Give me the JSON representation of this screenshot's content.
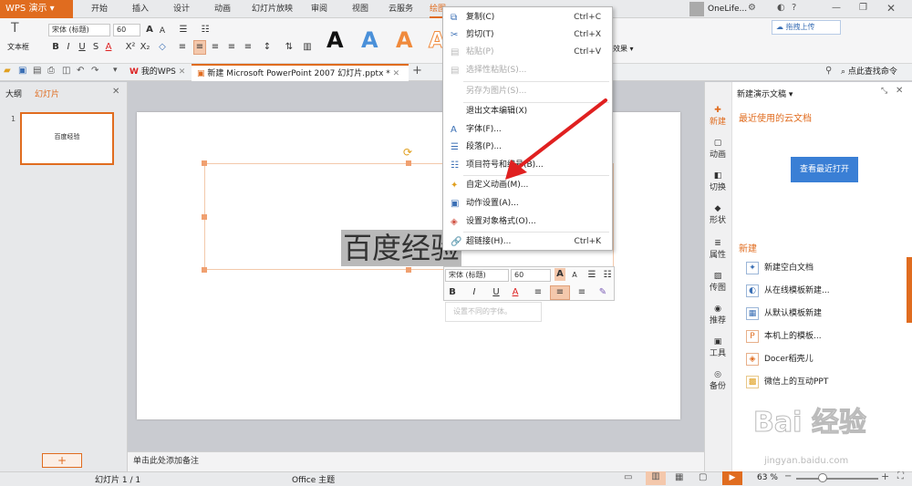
{
  "app": {
    "name": "WPS 演示"
  },
  "menu_tabs": [
    "开始",
    "插入",
    "设计",
    "动画",
    "幻灯片放映",
    "审阅",
    "视图",
    "云服务",
    "绘图"
  ],
  "user": {
    "name": "OneLife..."
  },
  "cloud_upload": "拖拽上传",
  "ribbon": {
    "textbox_label": "文本框",
    "font_name": "宋体 (标题)",
    "font_size": "60",
    "effects_label": "效果"
  },
  "doc_tabs": [
    {
      "label": "我的WPS"
    },
    {
      "label": "新建 Microsoft PowerPoint 2007 幻灯片.pptx *"
    }
  ],
  "search_command": "点此查找命令",
  "left_panel": {
    "tab_outline": "大纲",
    "tab_slides": "幻灯片",
    "slide_number": "1",
    "thumb_text": "百度经验"
  },
  "slide": {
    "text": "百度经验"
  },
  "notes_placeholder": "单击此处添加备注",
  "context_menu": [
    {
      "label": "复制(C)",
      "shortcut": "Ctrl+C",
      "icon": "copy-icon",
      "disabled": false
    },
    {
      "label": "剪切(T)",
      "shortcut": "Ctrl+X",
      "icon": "cut-icon",
      "disabled": false
    },
    {
      "label": "粘贴(P)",
      "shortcut": "Ctrl+V",
      "icon": "paste-icon",
      "disabled": true
    },
    {
      "label": "选择性粘贴(S)...",
      "shortcut": "",
      "icon": "paste-special-icon",
      "disabled": true
    },
    {
      "label": "另存为图片(S)...",
      "shortcut": "",
      "icon": "",
      "disabled": true
    },
    {
      "label": "退出文本编辑(X)",
      "shortcut": "",
      "icon": "",
      "disabled": false
    },
    {
      "label": "字体(F)...",
      "shortcut": "",
      "icon": "font-icon",
      "disabled": false
    },
    {
      "label": "段落(P)...",
      "shortcut": "",
      "icon": "paragraph-icon",
      "disabled": false
    },
    {
      "label": "项目符号和编号(B)...",
      "shortcut": "",
      "icon": "bullets-icon",
      "disabled": false
    },
    {
      "label": "自定义动画(M)...",
      "shortcut": "",
      "icon": "custom-animation-icon",
      "disabled": false
    },
    {
      "label": "动作设置(A)...",
      "shortcut": "",
      "icon": "action-settings-icon",
      "disabled": false
    },
    {
      "label": "设置对象格式(O)...",
      "shortcut": "",
      "icon": "format-object-icon",
      "disabled": false
    },
    {
      "label": "超链接(H)...",
      "shortcut": "Ctrl+K",
      "icon": "hyperlink-icon",
      "disabled": false
    }
  ],
  "mini_toolbar": {
    "font_name": "宋体 (标题)",
    "font_size": "60",
    "hint": "设置不同的字体。"
  },
  "side_tabs": [
    "新建",
    "动画",
    "切换",
    "形状",
    "属性",
    "传图",
    "推荐",
    "工具",
    "备份"
  ],
  "right_panel": {
    "header": "新建演示文稿",
    "recent_title": "最近使用的云文档",
    "view_recent_button": "查看最近打开",
    "new_title": "新建",
    "items": [
      "新建空白文档",
      "从在线模板新建...",
      "从默认模板新建",
      "本机上的模板...",
      "Docer稻壳儿",
      "微信上的互动PPT"
    ]
  },
  "status": {
    "slide_info": "幻灯片 1 / 1",
    "theme": "Office 主题",
    "zoom": "63 %"
  },
  "watermark": {
    "text": "Bai 经验",
    "url": "jingyan.baidu.com"
  },
  "colors": {
    "accent": "#e06c1f",
    "blue": "#3a7fd5",
    "red_arrow": "#e02020"
  }
}
